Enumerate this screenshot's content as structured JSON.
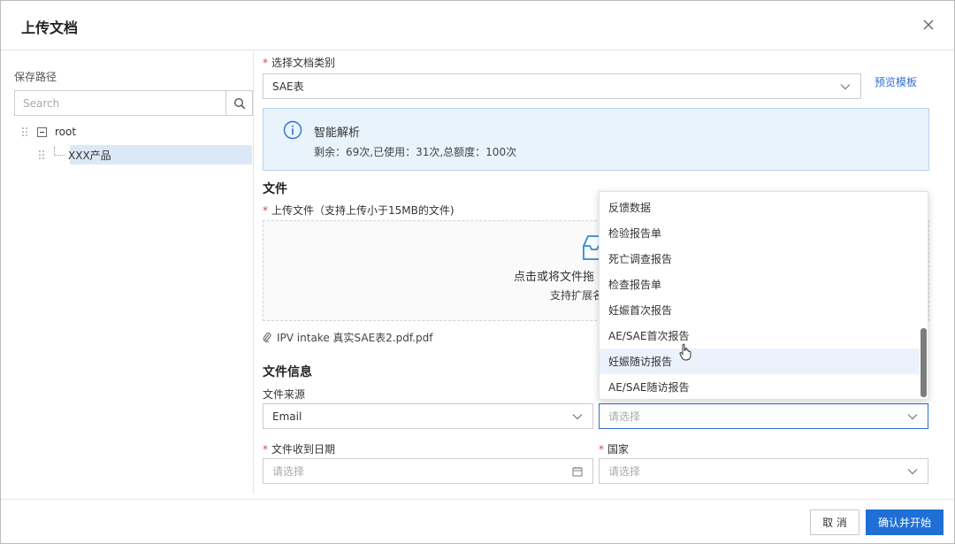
{
  "dialog": {
    "title": "上传文档"
  },
  "left": {
    "save_path_label": "保存路径",
    "search_placeholder": "Search",
    "tree": [
      {
        "label": "root"
      },
      {
        "label": "XXX产品",
        "selected": true
      }
    ]
  },
  "form": {
    "doc_type_label": "选择文档类别",
    "doc_type_value": "SAE表",
    "preview_link": "预览模板",
    "info": {
      "title": "智能解析",
      "text": "剩余：69次,已使用：31次,总额度：100次"
    },
    "file_section_title": "文件",
    "upload_label": "上传文件（支持上传小于15MB的文件)",
    "upload_text": "点击或将文件拖",
    "upload_sub": "支持扩展名",
    "uploaded_file": "IPV intake 真实SAE表2.pdf.pdf",
    "file_info_title": "文件信息",
    "source_label": "文件来源",
    "source_value": "Email",
    "second_select_placeholder": "请选择",
    "received_date_label": "文件收到日期",
    "received_date_placeholder": "请选择",
    "country_label": "国家",
    "country_placeholder": "请选择"
  },
  "dropdown": {
    "items": [
      "反馈数据",
      "检验报告单",
      "死亡调查报告",
      "检查报告单",
      "妊娠首次报告",
      "AE/SAE首次报告",
      "妊娠随访报告",
      "AE/SAE随访报告"
    ],
    "hover_index": 6
  },
  "footer": {
    "cancel_label": "取 消",
    "confirm_label": "确认并开始"
  },
  "colors": {
    "primary": "#1f6fd6",
    "link": "#2f6fd1",
    "required": "#e0443e",
    "info_bg": "#e8f3fc",
    "selected_bg": "#dde8f6"
  }
}
